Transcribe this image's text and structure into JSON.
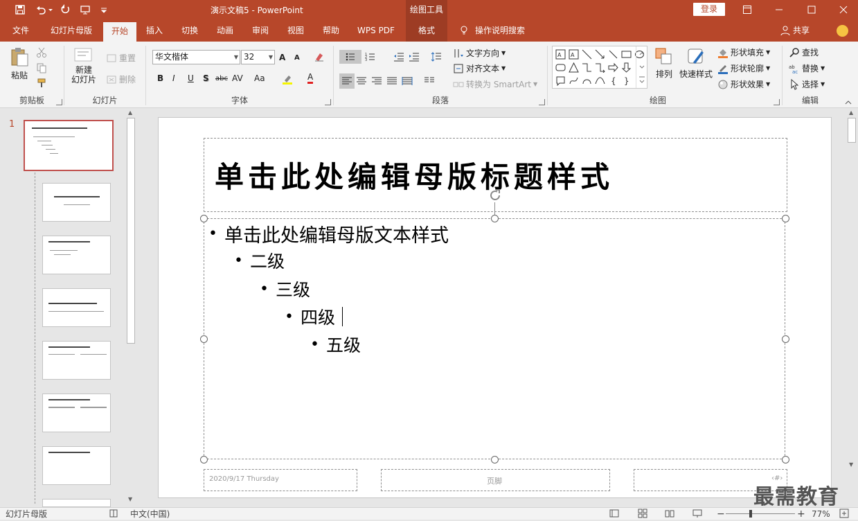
{
  "titlebar": {
    "doc_title": "演示文稿5  -  PowerPoint",
    "contextual_tools": "绘图工具",
    "login": "登录"
  },
  "tabs": [
    {
      "label": "文件"
    },
    {
      "label": "幻灯片母版"
    },
    {
      "label": "开始"
    },
    {
      "label": "插入"
    },
    {
      "label": "切换"
    },
    {
      "label": "动画"
    },
    {
      "label": "审阅"
    },
    {
      "label": "视图"
    },
    {
      "label": "帮助"
    },
    {
      "label": "WPS PDF"
    },
    {
      "label": "格式"
    },
    {
      "label": "操作说明搜索"
    }
  ],
  "share_label": "共享",
  "ribbon": {
    "clipboard": {
      "paste": "粘贴",
      "group": "剪贴板"
    },
    "slides": {
      "new_slide_1": "新建",
      "new_slide_2": "幻灯片",
      "reset": "重置",
      "delete": "删除",
      "group": "幻灯片"
    },
    "font": {
      "name": "华文楷体",
      "size": "32",
      "bold": "B",
      "italic": "I",
      "underline": "U",
      "shadow": "S",
      "strike": "abc",
      "spacing": "AV",
      "case": "Aa",
      "grow": "A",
      "shrink": "A",
      "color": "A",
      "group": "字体"
    },
    "paragraph": {
      "text_direction": "文字方向",
      "align_text": "对齐文本",
      "smartart": "转换为 SmartArt",
      "group": "段落"
    },
    "drawing": {
      "arrange": "排列",
      "quick_styles": "快速样式",
      "fill": "形状填充",
      "outline": "形状轮廓",
      "effects": "形状效果",
      "group": "绘图"
    },
    "editing": {
      "find": "查找",
      "replace": "替换",
      "select": "选择",
      "group": "编辑"
    }
  },
  "slide_number": "1",
  "slide": {
    "title": "单击此处编辑母版标题样式",
    "levels": [
      "单击此处编辑母版文本样式",
      "二级",
      "三级",
      "四级",
      "五级"
    ],
    "footer_date": "2020/9/17 Thursday",
    "footer_text": "页脚",
    "footer_num": "‹#›"
  },
  "watermark": "最需教育",
  "status": {
    "view": "幻灯片母版",
    "language": "中文(中国)",
    "zoom": "77%"
  },
  "colors": {
    "accent": "#b7472a",
    "selection": "#c0504d"
  }
}
